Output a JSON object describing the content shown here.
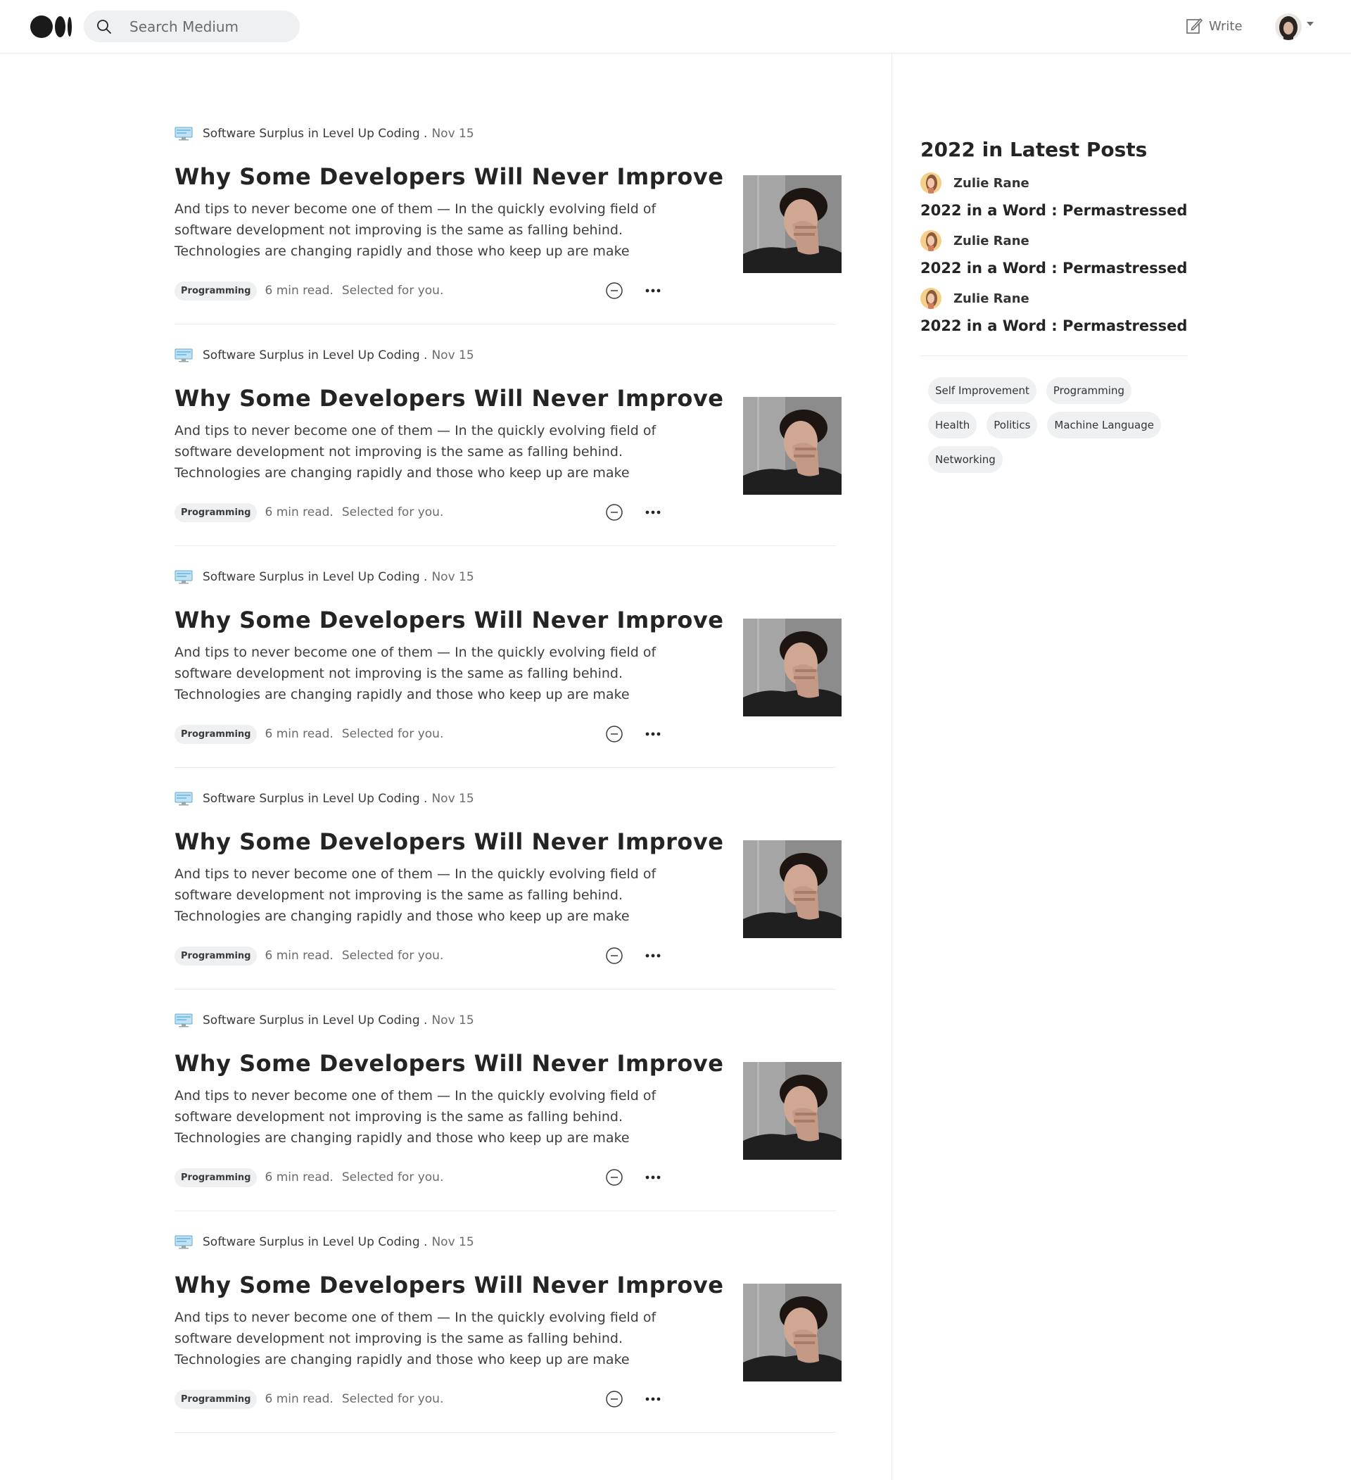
{
  "header": {
    "search_placeholder": "Search Medium",
    "write_label": "Write"
  },
  "feed": {
    "items": [
      {
        "author": "Software Surplus",
        "in_label": "in",
        "publication": "Level Up Coding",
        "date": "Nov 15",
        "title": "Why Some Developers Will Never Improve",
        "excerpt": "And tips to never become one of them — In the quickly evolving field of software development not improving is the same as falling behind. Technologies are changing rapidly and those who keep up are make the…",
        "tag": "Programming",
        "read_time": "6 min read.",
        "selected": "Selected for you."
      },
      {
        "author": "Software Surplus",
        "in_label": "in",
        "publication": "Level Up Coding",
        "date": "Nov 15",
        "title": "Why Some Developers Will Never Improve",
        "excerpt": "And tips to never become one of them — In the quickly evolving field of software development not improving is the same as falling behind. Technologies are changing rapidly and those who keep up are make the…",
        "tag": "Programming",
        "read_time": "6 min read.",
        "selected": "Selected for you."
      },
      {
        "author": "Software Surplus",
        "in_label": "in",
        "publication": "Level Up Coding",
        "date": "Nov 15",
        "title": "Why Some Developers Will Never Improve",
        "excerpt": "And tips to never become one of them — In the quickly evolving field of software development not improving is the same as falling behind. Technologies are changing rapidly and those who keep up are make the…",
        "tag": "Programming",
        "read_time": "6 min read.",
        "selected": "Selected for you."
      },
      {
        "author": "Software Surplus",
        "in_label": "in",
        "publication": "Level Up Coding",
        "date": "Nov 15",
        "title": "Why Some Developers Will Never Improve",
        "excerpt": "And tips to never become one of them — In the quickly evolving field of software development not improving is the same as falling behind. Technologies are changing rapidly and those who keep up are make the…",
        "tag": "Programming",
        "read_time": "6 min read.",
        "selected": "Selected for you."
      },
      {
        "author": "Software Surplus",
        "in_label": "in",
        "publication": "Level Up Coding",
        "date": "Nov 15",
        "title": "Why Some Developers Will Never Improve",
        "excerpt": "And tips to never become one of them — In the quickly evolving field of software development not improving is the same as falling behind. Technologies are changing rapidly and those who keep up are make the…",
        "tag": "Programming",
        "read_time": "6 min read.",
        "selected": "Selected for you."
      },
      {
        "author": "Software Surplus",
        "in_label": "in",
        "publication": "Level Up Coding",
        "date": "Nov 15",
        "title": "Why Some Developers Will Never Improve",
        "excerpt": "And tips to never become one of them — In the quickly evolving field of software development not improving is the same as falling behind. Technologies are changing rapidly and those who keep up are make the…",
        "tag": "Programming",
        "read_time": "6 min read.",
        "selected": "Selected for you."
      }
    ]
  },
  "sidebar": {
    "title": "2022 in Latest Posts",
    "posts": [
      {
        "author": "Zulie Rane",
        "title": "2022 in a Word : Permastressed"
      },
      {
        "author": "Zulie Rane",
        "title": "2022 in a Word : Permastressed"
      },
      {
        "author": "Zulie Rane",
        "title": "2022 in a Word : Permastressed"
      }
    ],
    "topics": [
      "Self Improvement",
      "Programming",
      "Health",
      "Politics",
      "Machine Language",
      "Networking"
    ]
  },
  "icons": {
    "logo": "medium-logo",
    "search": "search-icon",
    "write": "write-icon",
    "show_less": "minus-circle-icon",
    "more": "more-dots-icon",
    "publication": "monitor-icon"
  },
  "colors": {
    "accent_text": "#242424",
    "muted_text": "#6b6b6b",
    "pill_bg": "#eef0f2",
    "divider": "#ececec"
  }
}
